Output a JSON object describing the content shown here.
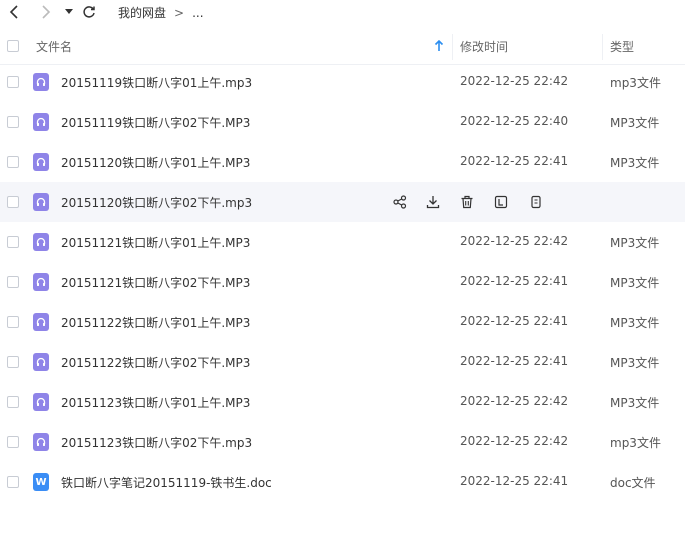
{
  "nav": {
    "breadcrumb_root": "我的网盘",
    "breadcrumb_sep": ">",
    "breadcrumb_more": "..."
  },
  "header": {
    "name": "文件名",
    "modified": "修改时间",
    "type": "类型"
  },
  "files": [
    {
      "name": "20151119铁口断八字01上午.mp3",
      "modified": "2022-12-25 22:42",
      "type": "mp3文件",
      "icon": "audio-file-icon"
    },
    {
      "name": "20151119铁口断八字02下午.MP3",
      "modified": "2022-12-25 22:40",
      "type": "MP3文件",
      "icon": "audio-file-icon"
    },
    {
      "name": "20151120铁口断八字01上午.MP3",
      "modified": "2022-12-25 22:41",
      "type": "MP3文件",
      "icon": "audio-file-icon"
    },
    {
      "name": "20151120铁口断八字02下午.mp3",
      "modified": "",
      "type": "",
      "icon": "audio-file-icon",
      "hovered": true
    },
    {
      "name": "20151121铁口断八字01上午.MP3",
      "modified": "2022-12-25 22:42",
      "type": "MP3文件",
      "icon": "audio-file-icon"
    },
    {
      "name": "20151121铁口断八字02下午.MP3",
      "modified": "2022-12-25 22:41",
      "type": "MP3文件",
      "icon": "audio-file-icon"
    },
    {
      "name": "20151122铁口断八字01上午.MP3",
      "modified": "2022-12-25 22:41",
      "type": "MP3文件",
      "icon": "audio-file-icon"
    },
    {
      "name": "20151122铁口断八字02下午.MP3",
      "modified": "2022-12-25 22:41",
      "type": "MP3文件",
      "icon": "audio-file-icon"
    },
    {
      "name": "20151123铁口断八字01上午.MP3",
      "modified": "2022-12-25 22:42",
      "type": "MP3文件",
      "icon": "audio-file-icon"
    },
    {
      "name": "20151123铁口断八字02下午.mp3",
      "modified": "2022-12-25 22:42",
      "type": "mp3文件",
      "icon": "audio-file-icon"
    },
    {
      "name": "铁口断八字笔记20151119-铁书生.doc",
      "modified": "2022-12-25 22:41",
      "type": "doc文件",
      "icon": "word-doc-icon",
      "icon_letter": "W"
    }
  ],
  "colors": {
    "audio_icon": "#8f84e8",
    "doc_icon": "#3a8df5",
    "sort_arrow": "#2b8ef0",
    "hover_row": "#f5f6fa"
  }
}
